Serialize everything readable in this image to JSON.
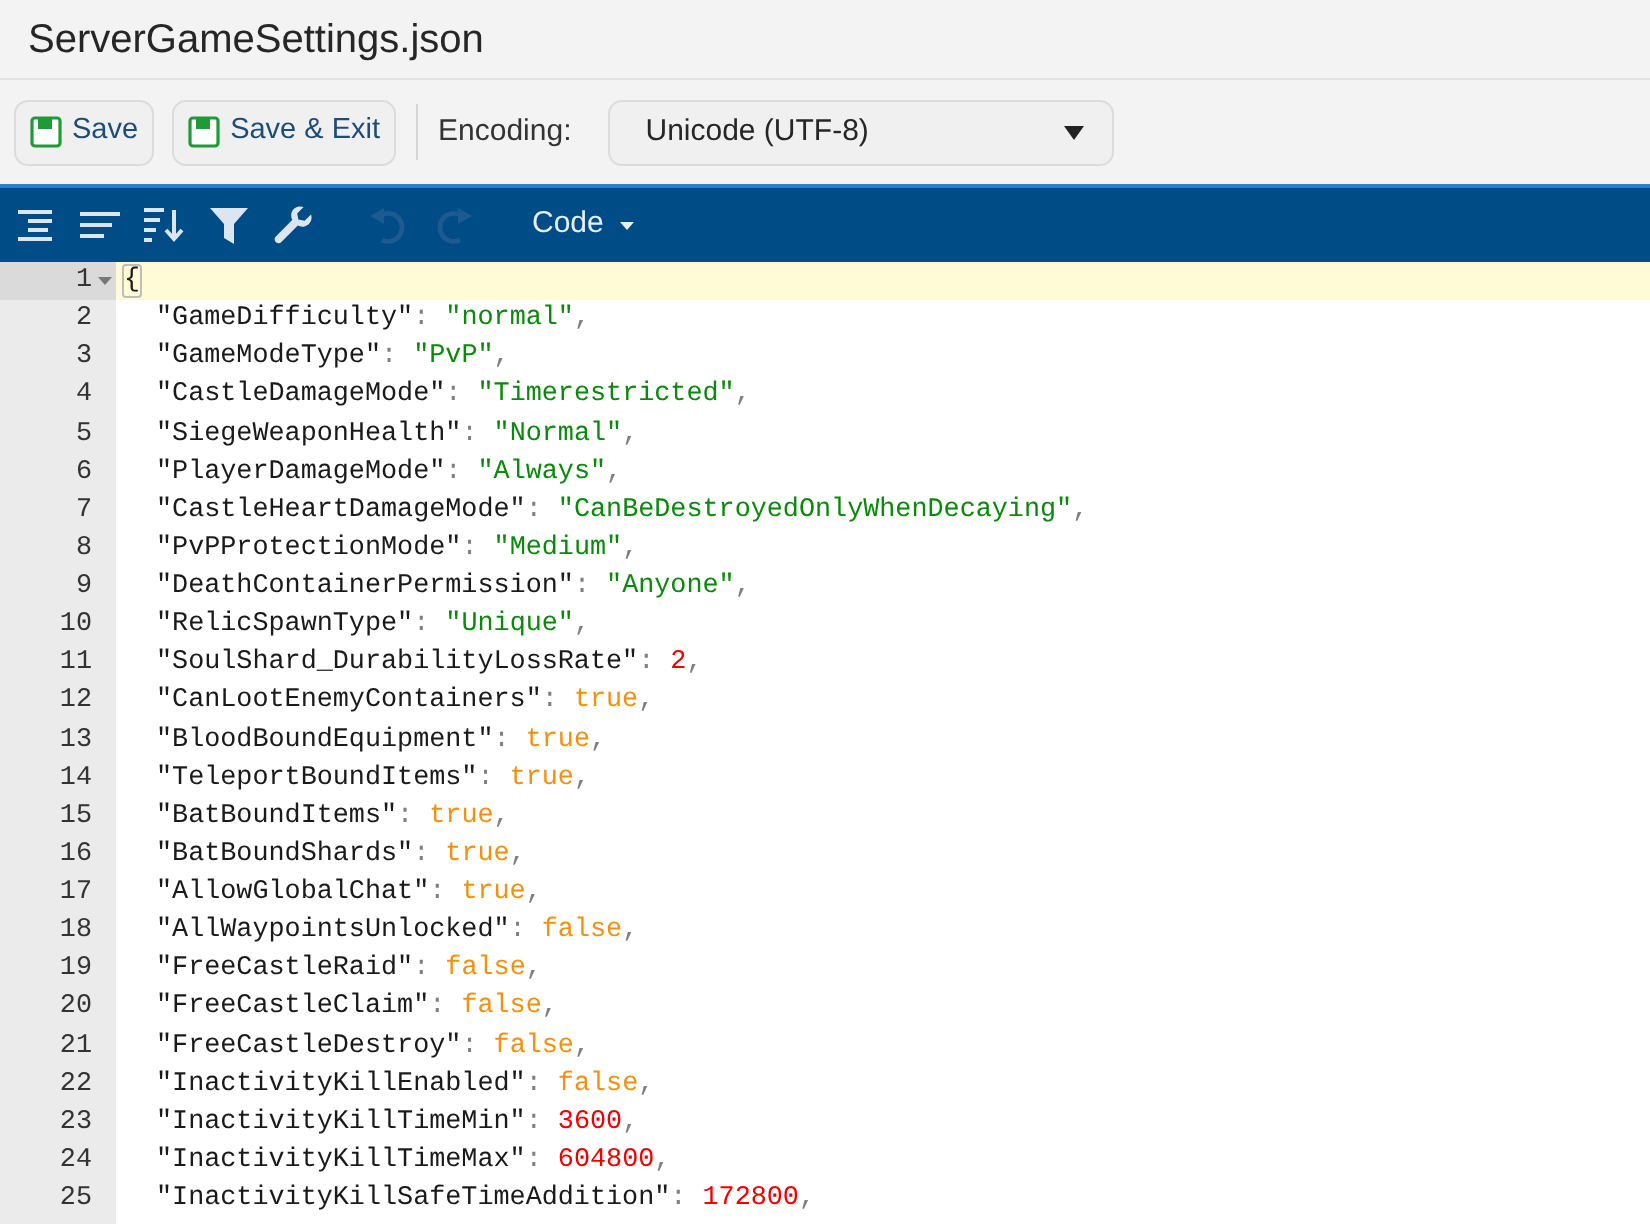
{
  "title": "ServerGameSettings.json",
  "toolbar": {
    "buttons": [
      {
        "label": "Save"
      },
      {
        "label": "Save & Exit"
      }
    ],
    "encoding": {
      "label": "Encoding:",
      "value": "Unicode (UTF-8)"
    }
  },
  "editor_menu": {
    "undo": {
      "disabled": true
    },
    "redo": {
      "disabled": true
    },
    "mode": "Code"
  },
  "editor": {
    "lines": [
      {
        "number": "1",
        "current": true,
        "expanded": true,
        "kind": "brace",
        "value": "{",
        "children": [
          {
            "number": "2",
            "current": false,
            "key": "\"GameDifficulty\"",
            "colon": ":",
            "value": "\"normal\"",
            "kind": "string",
            "comma": ","
          },
          {
            "number": "3",
            "current": false,
            "key": "\"GameModeType\"",
            "colon": ":",
            "value": "\"PvP\"",
            "kind": "string",
            "comma": ","
          },
          {
            "number": "4",
            "current": false,
            "key": "\"CastleDamageMode\"",
            "colon": ":",
            "value": "\"Timerestricted\"",
            "kind": "string",
            "comma": ","
          },
          {
            "number": "5",
            "current": false,
            "key": "\"SiegeWeaponHealth\"",
            "colon": ":",
            "value": "\"Normal\"",
            "kind": "string",
            "comma": ","
          },
          {
            "number": "6",
            "current": false,
            "key": "\"PlayerDamageMode\"",
            "colon": ":",
            "value": "\"Always\"",
            "kind": "string",
            "comma": ","
          },
          {
            "number": "7",
            "current": false,
            "key": "\"CastleHeartDamageMode\"",
            "colon": ":",
            "value": "\"CanBeDestroyedOnlyWhenDecaying\"",
            "kind": "string",
            "comma": ","
          },
          {
            "number": "8",
            "current": false,
            "key": "\"PvPProtectionMode\"",
            "colon": ":",
            "value": "\"Medium\"",
            "kind": "string",
            "comma": ","
          },
          {
            "number": "9",
            "current": false,
            "key": "\"DeathContainerPermission\"",
            "colon": ":",
            "value": "\"Anyone\"",
            "kind": "string",
            "comma": ","
          },
          {
            "number": "10",
            "current": false,
            "key": "\"RelicSpawnType\"",
            "colon": ":",
            "value": "\"Unique\"",
            "kind": "string",
            "comma": ","
          },
          {
            "number": "11",
            "current": false,
            "key": "\"SoulShard_DurabilityLossRate\"",
            "colon": ":",
            "value": "2",
            "kind": "number",
            "comma": ","
          },
          {
            "number": "12",
            "current": false,
            "key": "\"CanLootEnemyContainers\"",
            "colon": ":",
            "value": "true",
            "kind": "boolean",
            "comma": ","
          },
          {
            "number": "13",
            "current": false,
            "key": "\"BloodBoundEquipment\"",
            "colon": ":",
            "value": "true",
            "kind": "boolean",
            "comma": ","
          },
          {
            "number": "14",
            "current": false,
            "key": "\"TeleportBoundItems\"",
            "colon": ":",
            "value": "true",
            "kind": "boolean",
            "comma": ","
          },
          {
            "number": "15",
            "current": false,
            "key": "\"BatBoundItems\"",
            "colon": ":",
            "value": "true",
            "kind": "boolean",
            "comma": ","
          },
          {
            "number": "16",
            "current": false,
            "key": "\"BatBoundShards\"",
            "colon": ":",
            "value": "true",
            "kind": "boolean",
            "comma": ","
          },
          {
            "number": "17",
            "current": false,
            "key": "\"AllowGlobalChat\"",
            "colon": ":",
            "value": "true",
            "kind": "boolean",
            "comma": ","
          },
          {
            "number": "18",
            "current": false,
            "key": "\"AllWaypointsUnlocked\"",
            "colon": ":",
            "value": "false",
            "kind": "boolean",
            "comma": ","
          },
          {
            "number": "19",
            "current": false,
            "key": "\"FreeCastleRaid\"",
            "colon": ":",
            "value": "false",
            "kind": "boolean",
            "comma": ","
          },
          {
            "number": "20",
            "current": false,
            "key": "\"FreeCastleClaim\"",
            "colon": ":",
            "value": "false",
            "kind": "boolean",
            "comma": ","
          },
          {
            "number": "21",
            "current": false,
            "key": "\"FreeCastleDestroy\"",
            "colon": ":",
            "value": "false",
            "kind": "boolean",
            "comma": ","
          },
          {
            "number": "22",
            "current": false,
            "key": "\"InactivityKillEnabled\"",
            "colon": ":",
            "value": "false",
            "kind": "boolean",
            "comma": ","
          },
          {
            "number": "23",
            "current": false,
            "key": "\"InactivityKillTimeMin\"",
            "colon": ":",
            "value": "3600",
            "kind": "number",
            "comma": ","
          },
          {
            "number": "24",
            "current": false,
            "key": "\"InactivityKillTimeMax\"",
            "colon": ":",
            "value": "604800",
            "kind": "number",
            "comma": ","
          },
          {
            "number": "25",
            "current": false,
            "key": "\"InactivityKillSafeTimeAddition\"",
            "colon": ":",
            "value": "172800",
            "kind": "number",
            "comma": ","
          }
        ]
      }
    ]
  }
}
